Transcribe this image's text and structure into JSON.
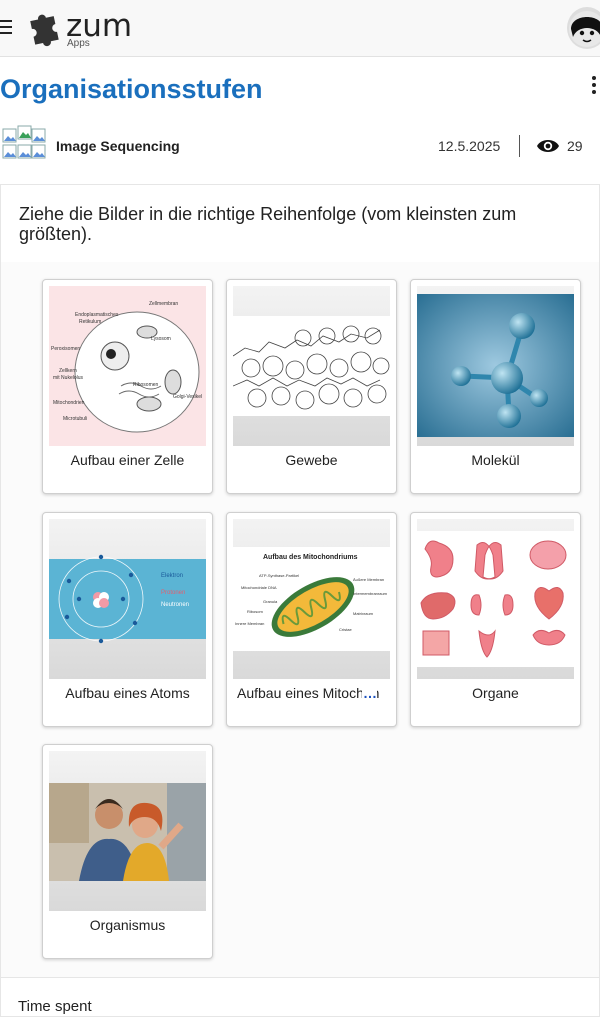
{
  "header": {
    "logo_text": "zum",
    "logo_sub": "Apps",
    "avatar_alt": "user avatar"
  },
  "page": {
    "title": "Organisationsstufen",
    "app_type": "Image Sequencing",
    "date": "12.5.2025",
    "views": "29"
  },
  "task": {
    "instruction": "Ziehe die Bilder in die richtige Reihenfolge (vom kleinsten zum größten)."
  },
  "tiles": [
    {
      "caption": "Aufbau einer Zelle",
      "image": "cell-diagram"
    },
    {
      "caption": "Gewebe",
      "image": "tissue-drawing"
    },
    {
      "caption": "Molekül",
      "image": "molecule-render"
    },
    {
      "caption": "Aufbau eines Atoms",
      "image": "atom-diagram"
    },
    {
      "caption": "Aufbau eines Mitochondriums",
      "image": "mitochondrium-diagram",
      "image_title": "Aufbau des Mitochondriums"
    },
    {
      "caption": "Organe",
      "image": "organs-illustration"
    },
    {
      "caption": "Organismus",
      "image": "people-photo"
    }
  ],
  "footer": {
    "label": "Time spent"
  },
  "colors": {
    "title": "#1a6fbd",
    "ellipsis": "#1a4fbd"
  }
}
